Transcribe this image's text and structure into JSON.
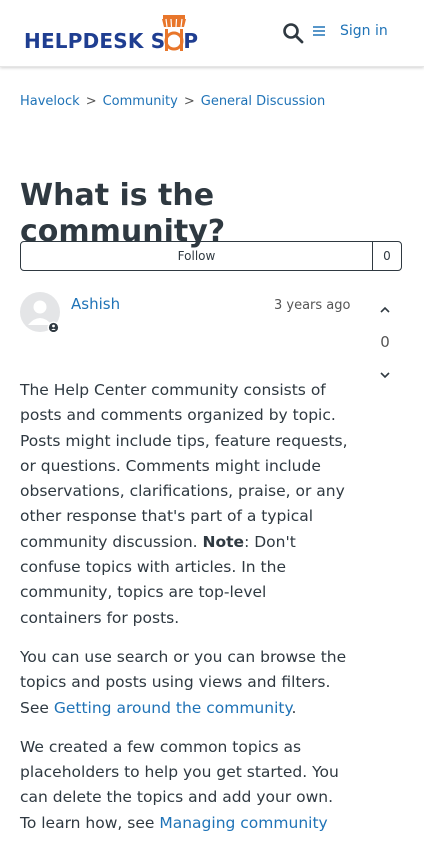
{
  "header": {
    "logo_text_1": "HELPDESK S",
    "logo_text_2": "P",
    "signin_label": "Sign in"
  },
  "breadcrumb": [
    "Havelock",
    "Community",
    "General Discussion"
  ],
  "breadcrumb_separator": ">",
  "post": {
    "title": "What is the community?",
    "follow_label": "Follow",
    "follow_count": "0",
    "author": "Ashish",
    "time": "3 years ago",
    "vote_count": "0",
    "p1_a": "The Help Center community consists of posts and comments organized by topic. Posts might include tips, feature requests, or questions. Comments might include observations, clarifications, praise, or any other response that's part of a typical community discussion. ",
    "p1_note": "Note",
    "p1_b": ": Don't confuse topics with articles. In the community, topics are top-level containers for posts.",
    "p2_a": "You can use search or you can browse the topics and posts using views and filters. See ",
    "p2_link": "Getting around the community",
    "p2_b": ".",
    "p3_a": "We created a few common topics as placeholders to help you get started. You can delete the topics and add your own. To learn how, see ",
    "p3_link": "Managing community"
  },
  "colors": {
    "brand_blue": "#1f3e91",
    "brand_orange": "#e8762b",
    "link": "#1f73b7",
    "text": "#2f3941"
  }
}
